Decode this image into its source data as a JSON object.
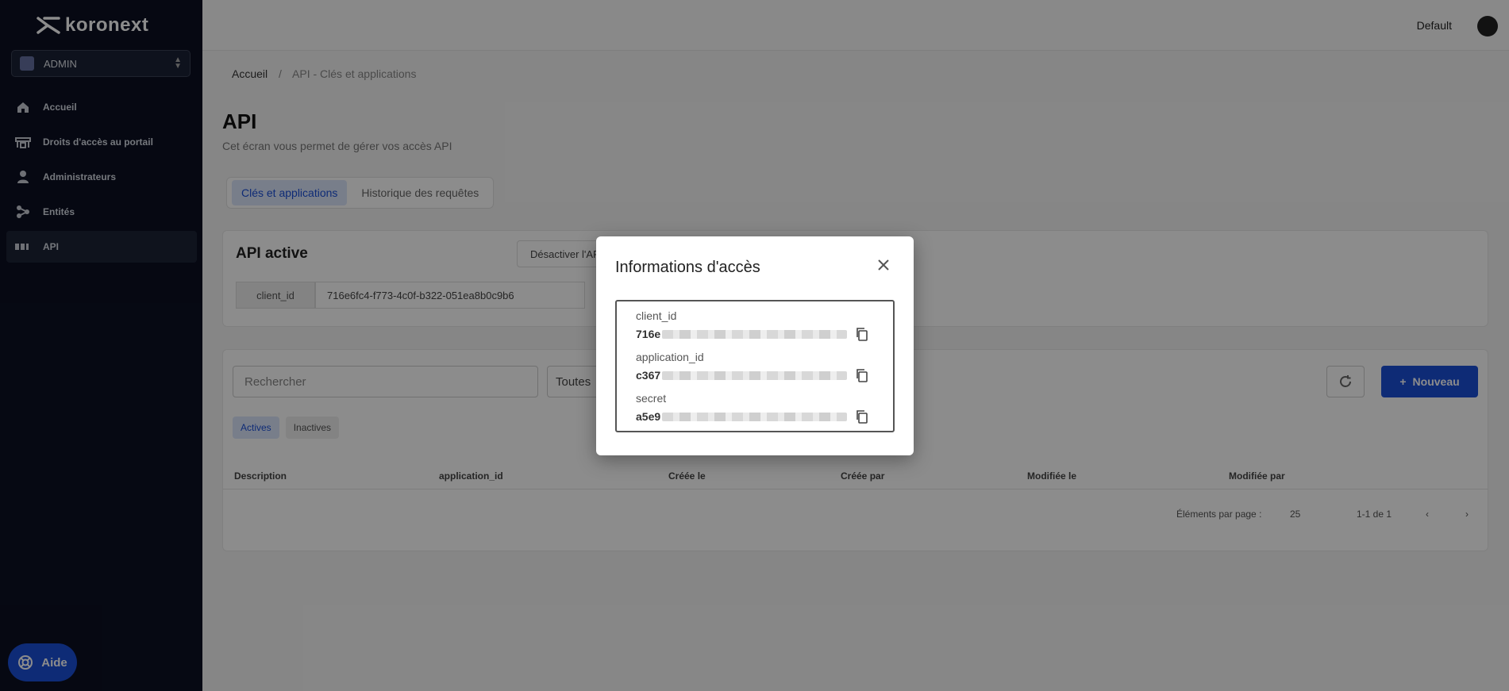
{
  "sidebar": {
    "logo_text": "koronext",
    "tenant": "ADMIN",
    "items": [
      {
        "label": "Accueil",
        "icon": "home-icon"
      },
      {
        "label": "Droits d'accès au portail",
        "icon": "shield-icon"
      },
      {
        "label": "Administrateurs",
        "icon": "user-icon"
      },
      {
        "label": "Entités",
        "icon": "hierarchy-icon"
      },
      {
        "label": "API",
        "icon": "api-icon"
      }
    ],
    "help_label": "Aide"
  },
  "topbar": {
    "workspace": "Default"
  },
  "breadcrumb": {
    "home": "Accueil",
    "separator": "/",
    "current": "API - Clés et applications"
  },
  "page": {
    "title": "API",
    "subtitle": "Cet écran vous permet de gérer vos accès API",
    "tabs": [
      "Clés et applications",
      "Historique des requêtes"
    ]
  },
  "api_card": {
    "title": "API active",
    "deactivate_label": "Désactiver l'API",
    "client_id_label": "client_id",
    "client_id_value": "716e6fc4-f773-4c0f-b322-051ea8b0c9b6"
  },
  "list_card": {
    "search_placeholder": "Rechercher",
    "filter_value": "Toutes",
    "new_label": "Nouveau",
    "chips": [
      "Actives",
      "Inactives"
    ],
    "columns": [
      "Description",
      "application_id",
      "Créée le",
      "Créée par",
      "Modifiée le",
      "Modifiée par"
    ],
    "pager": {
      "per_page_label": "Éléments par page :",
      "per_page_value": "25",
      "range": "1-1 de 1"
    }
  },
  "modal": {
    "title": "Informations d'accès",
    "fields": [
      {
        "label": "client_id",
        "value_prefix": "716e"
      },
      {
        "label": "application_id",
        "value_prefix": "c367"
      },
      {
        "label": "secret",
        "value_prefix": "a5e9"
      }
    ]
  }
}
